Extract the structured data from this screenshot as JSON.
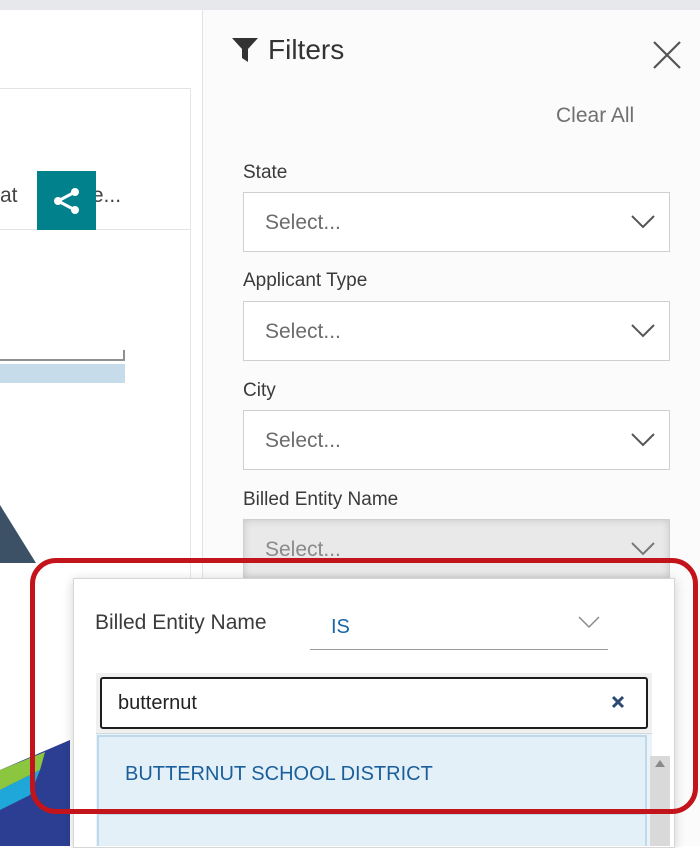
{
  "background": {
    "card_text_left": "at",
    "card_text_right": "lue..."
  },
  "filters": {
    "title": "Filters",
    "clear_all": "Clear All",
    "fields": [
      {
        "label": "State",
        "placeholder": "Select..."
      },
      {
        "label": "Applicant Type",
        "placeholder": "Select..."
      },
      {
        "label": "City",
        "placeholder": "Select..."
      },
      {
        "label": "Billed Entity Name",
        "placeholder": "Select..."
      }
    ]
  },
  "popup": {
    "field_label": "Billed Entity Name",
    "operator": "IS",
    "search_value": "butternut",
    "options": [
      "BUTTERNUT SCHOOL DISTRICT"
    ]
  },
  "colors": {
    "accent_teal": "#00818c",
    "highlight_red": "#c4141b",
    "link_blue": "#1b64a8"
  },
  "icons": [
    "share-icon",
    "filter-icon",
    "close-icon",
    "chevron-down-icon",
    "clear-icon",
    "scroll-up-icon"
  ]
}
